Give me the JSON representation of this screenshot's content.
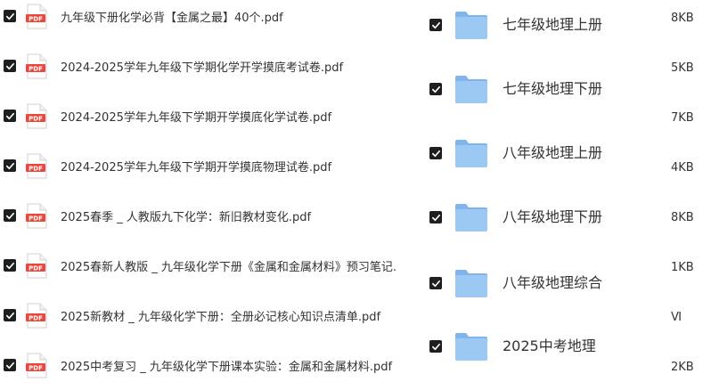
{
  "colors": {
    "checkbox": "#1f1f1f",
    "pdf_red": "#e64a3c",
    "folder_blue": "#8fbff0"
  },
  "files": [
    {
      "name": "九年级下册化学必背【金属之最】40个.pdf",
      "checked": true,
      "icon": "pdf-file-icon"
    },
    {
      "name": "2024-2025学年九年级下学期化学开学摸底考试卷.pdf",
      "checked": true,
      "icon": "pdf-file-icon"
    },
    {
      "name": "2024-2025学年九年级下学期开学摸底化学试卷.pdf",
      "checked": true,
      "icon": "pdf-file-icon"
    },
    {
      "name": "2024-2025学年九年级下学期开学摸底物理试卷.pdf",
      "checked": true,
      "icon": "pdf-file-icon"
    },
    {
      "name": "2025春季 _ 人教版九下化学：新旧教材变化.pdf",
      "checked": true,
      "icon": "pdf-file-icon"
    },
    {
      "name": "2025春新人教版 _ 九年级化学下册《金属和金属材料》预习笔记.",
      "checked": true,
      "icon": "pdf-file-icon"
    },
    {
      "name": "2025新教材 _ 九年级化学下册：全册必记核心知识点清单.pdf",
      "checked": true,
      "icon": "pdf-file-icon"
    },
    {
      "name": "2025中考复习 _ 九年级化学下册课本实验：金属和金属材料.pdf",
      "checked": true,
      "icon": "pdf-file-icon"
    }
  ],
  "sizes": [
    "8KB",
    "5KB",
    "7KB",
    "4KB",
    "8KB",
    "1KB",
    "Ⅵ",
    "2KB"
  ],
  "folders": [
    {
      "name": "七年级地理上册",
      "checked": true,
      "icon": "folder-icon"
    },
    {
      "name": "七年级地理下册",
      "checked": true,
      "icon": "folder-icon"
    },
    {
      "name": "八年级地理上册",
      "checked": true,
      "icon": "folder-icon"
    },
    {
      "name": "八年级地理下册",
      "checked": true,
      "icon": "folder-icon"
    },
    {
      "name": "八年级地理综合",
      "checked": true,
      "icon": "folder-icon"
    },
    {
      "name": "2025中考地理",
      "checked": true,
      "icon": "folder-icon"
    }
  ]
}
